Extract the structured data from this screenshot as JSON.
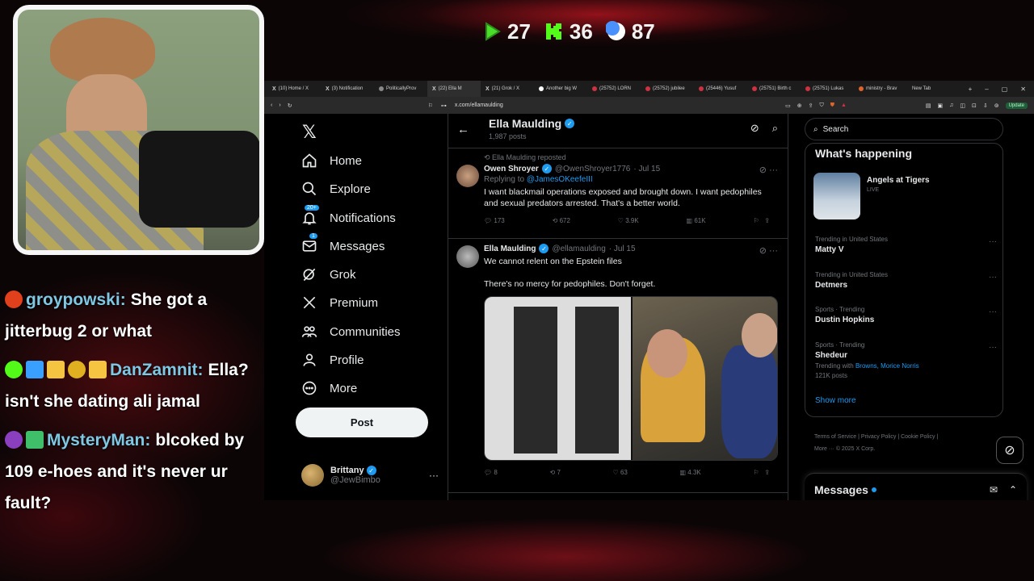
{
  "overlay": {
    "stats": [
      {
        "icon": "play-icon",
        "value": "27",
        "color": "#4ade2b"
      },
      {
        "icon": "kick-icon",
        "value": "36",
        "color": "#53fc18"
      },
      {
        "icon": "moon-icon",
        "value": "87",
        "color": "#4a90ff"
      }
    ],
    "chat": [
      {
        "user": "groypowski:",
        "message": "She got a jitterbug 2 or what",
        "user_color": "#7ec8e3"
      },
      {
        "user": "DanZamnit:",
        "message": "Ella? isn't she dating ali jamal",
        "user_color": "#7ec8e3"
      },
      {
        "user": "MysteryMan:",
        "message": "blcoked by 109 e-hoes and it's never ur fault?",
        "user_color": "#7ec8e3"
      }
    ]
  },
  "browser": {
    "tabs": [
      {
        "label": "(10) Home / X"
      },
      {
        "label": "(3) Notification"
      },
      {
        "label": "PoliticallyProv"
      },
      {
        "label": "(22) Ella M"
      },
      {
        "label": "(21) Grok / X"
      },
      {
        "label": "Another big W"
      },
      {
        "label": "(25752) LORN"
      },
      {
        "label": "(25752) jubilee"
      },
      {
        "label": "(25446) Yusuf"
      },
      {
        "label": "(25751) Birth c"
      },
      {
        "label": "(25751) Lukas"
      },
      {
        "label": "ministry - Brav"
      },
      {
        "label": "New Tab"
      }
    ],
    "url": "x.com/ellamaulding",
    "update_label": "Update"
  },
  "nav": {
    "items": [
      {
        "label": "Home",
        "icon": "home-icon"
      },
      {
        "label": "Explore",
        "icon": "search-icon"
      },
      {
        "label": "Notifications",
        "icon": "bell-icon",
        "badge": "20+"
      },
      {
        "label": "Messages",
        "icon": "mail-icon",
        "badge": "1"
      },
      {
        "label": "Grok",
        "icon": "grok-icon"
      },
      {
        "label": "Premium",
        "icon": "x-icon"
      },
      {
        "label": "Communities",
        "icon": "people-icon"
      },
      {
        "label": "Profile",
        "icon": "person-icon"
      },
      {
        "label": "More",
        "icon": "more-circle-icon"
      }
    ],
    "post_label": "Post",
    "account": {
      "name": "Brittany",
      "handle": "@JewBimbo"
    }
  },
  "profile": {
    "name": "Ella Maulding",
    "post_count": "1,987 posts"
  },
  "tweets": [
    {
      "repost_line": "Ella Maulding reposted",
      "name": "Owen Shroyer",
      "handle": "@OwenShroyer1776",
      "date": "· Jul 15",
      "reply_to_prefix": "Replying to",
      "reply_to": "@JamesOKeefeIII",
      "text": "I want blackmail operations exposed and brought down. I want pedophiles and sexual predators arrested. That's a better world.",
      "replies": "173",
      "reposts": "672",
      "likes": "3.9K",
      "views": "61K"
    },
    {
      "name": "Ella Maulding",
      "handle": "@ellamaulding",
      "date": "· Jul 15",
      "text_line1": "We cannot relent on the Epstein files",
      "text_line2": "There's no mercy for pedophiles. Don't forget.",
      "replies": "8",
      "reposts": "7",
      "likes": "63",
      "views": "4.3K"
    }
  ],
  "sidebar": {
    "search_placeholder": "Search",
    "section_title": "What's happening",
    "event": {
      "title": "Angels at Tigers",
      "status": "LIVE"
    },
    "trends": [
      {
        "context": "Trending in United States",
        "name": "Matty V"
      },
      {
        "context": "Trending in United States",
        "name": "Detmers"
      },
      {
        "context": "Sports · Trending",
        "name": "Dustin Hopkins"
      },
      {
        "context": "Sports · Trending",
        "name": "Shedeur",
        "extra_prefix": "Trending with",
        "extra_links": "Browns, Morice Norris",
        "posts": "121K posts"
      }
    ],
    "show_more": "Show more",
    "footer": {
      "line1": "Terms of Service  |  Privacy Policy  |  Cookie Policy  |",
      "line2": "More ···   © 2025 X Corp."
    },
    "messages_title": "Messages"
  }
}
